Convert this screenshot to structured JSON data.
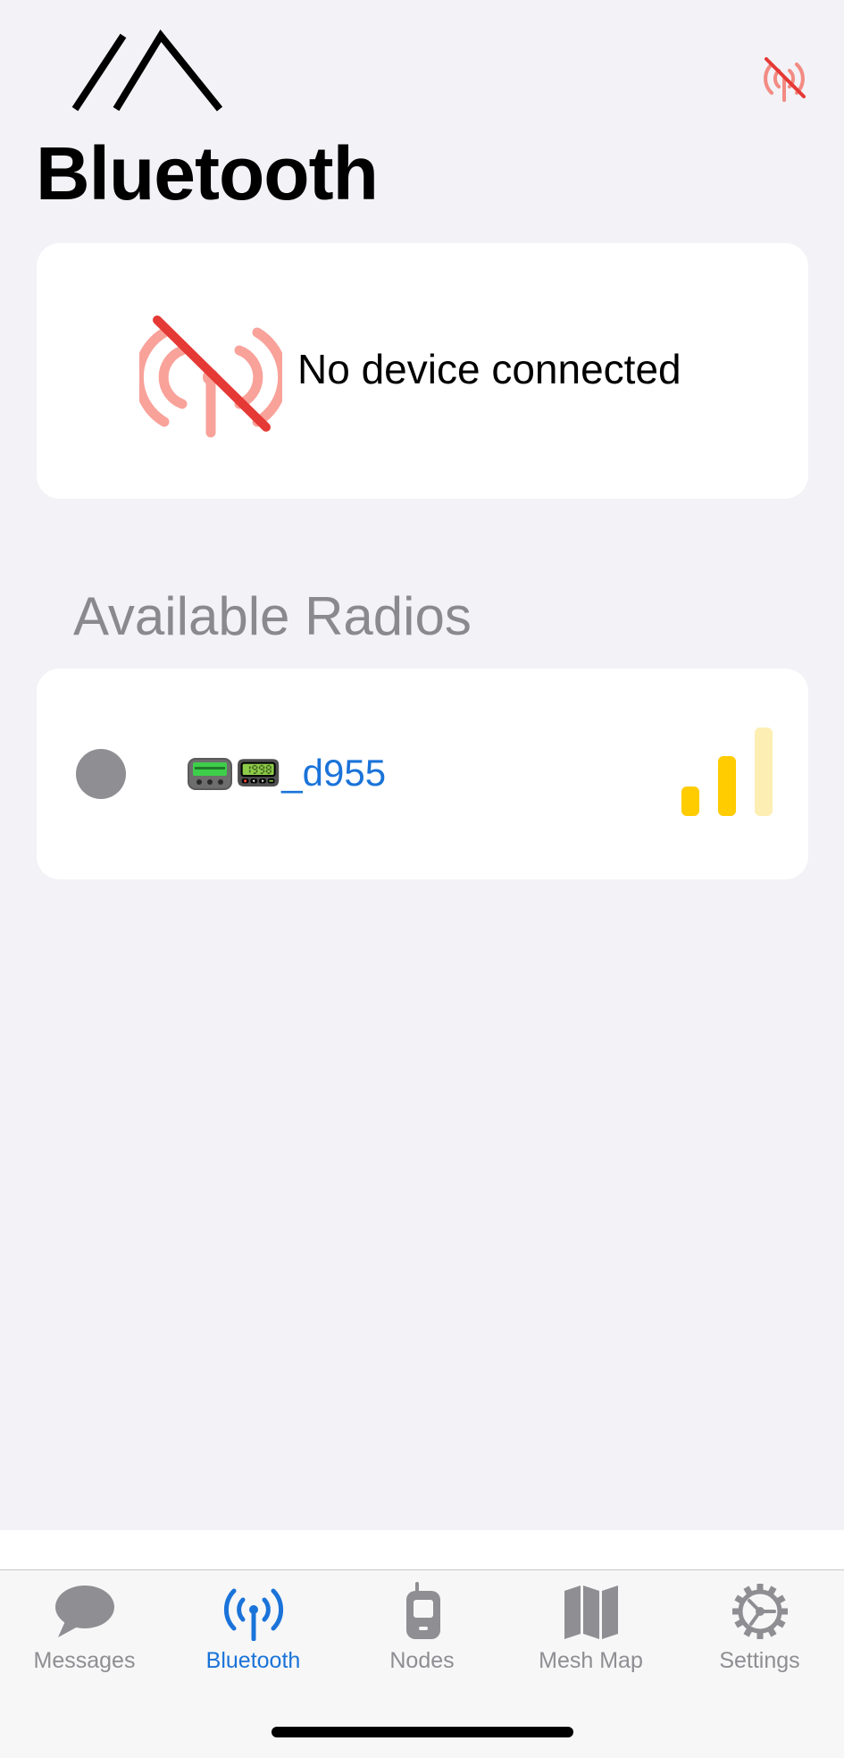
{
  "header": {
    "title": "Bluetooth",
    "logo_icon": "meshtastic-logo-icon",
    "status_icon": "antenna-disconnected-icon"
  },
  "connection": {
    "status_text": "No device connected",
    "icon": "antenna-disconnected-icon"
  },
  "available_radios": {
    "section_title": "Available Radios",
    "items": [
      {
        "name": "📟_d955",
        "connection_state_icon": "radio-status-dot",
        "signal_bars_filled": 2,
        "signal_bars_total": 3
      }
    ]
  },
  "tabbar": {
    "tabs": [
      {
        "label": "Messages",
        "icon": "speech-bubble-icon",
        "active": false
      },
      {
        "label": "Bluetooth",
        "icon": "antenna-icon",
        "active": true
      },
      {
        "label": "Nodes",
        "icon": "flip-phone-icon",
        "active": false
      },
      {
        "label": "Mesh Map",
        "icon": "map-icon",
        "active": false
      },
      {
        "label": "Settings",
        "icon": "gear-icon",
        "active": false
      }
    ]
  },
  "colors": {
    "accent": "#1a73d9",
    "disconnected": "#f05a5a",
    "signal": "#ffcc00",
    "signal_dim": "#fdeeb3",
    "background": "#f2f2f7",
    "inactive": "#8e8e93"
  }
}
